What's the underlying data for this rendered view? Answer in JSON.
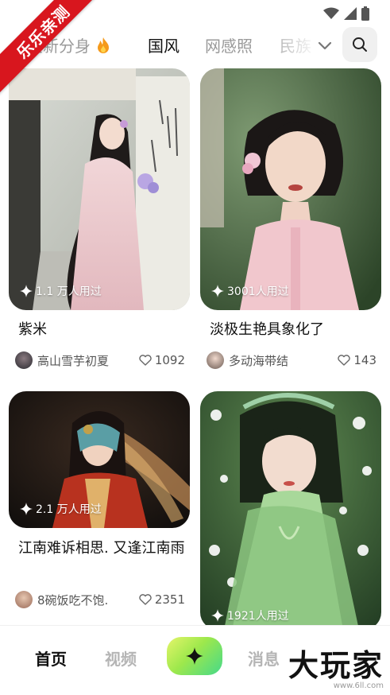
{
  "ribbon": {
    "label": "乐乐亲测"
  },
  "tabs": {
    "items": [
      {
        "label": "全新分身"
      },
      {
        "label": "国风",
        "active": true
      },
      {
        "label": "网感照"
      },
      {
        "label": "民族"
      }
    ],
    "new_badge_icon": "fire-icon",
    "expand_icon": "chevron-down-icon",
    "search_icon": "search-icon",
    "accent_color": "#c6f04a"
  },
  "cards": [
    {
      "usage": "1.1 万人用过",
      "title": "紫米",
      "author": "高山雪芋初夏",
      "likes": "1092"
    },
    {
      "usage": "3001人用过",
      "title": "淡极生艳具象化了",
      "author": "多动海带结",
      "likes": "143"
    },
    {
      "usage": "2.1 万人用过",
      "title": "江南难诉相思. 又逢江南雨",
      "author": "8碗饭吃不饱.",
      "likes": "2351"
    },
    {
      "usage": "1921人用过"
    }
  ],
  "nav": {
    "home": "首页",
    "video": "视频",
    "message": "消息",
    "create_icon": "sparkle-icon",
    "active": "home"
  },
  "watermark": {
    "main": "大玩家",
    "sub": "www.6ll.com"
  }
}
